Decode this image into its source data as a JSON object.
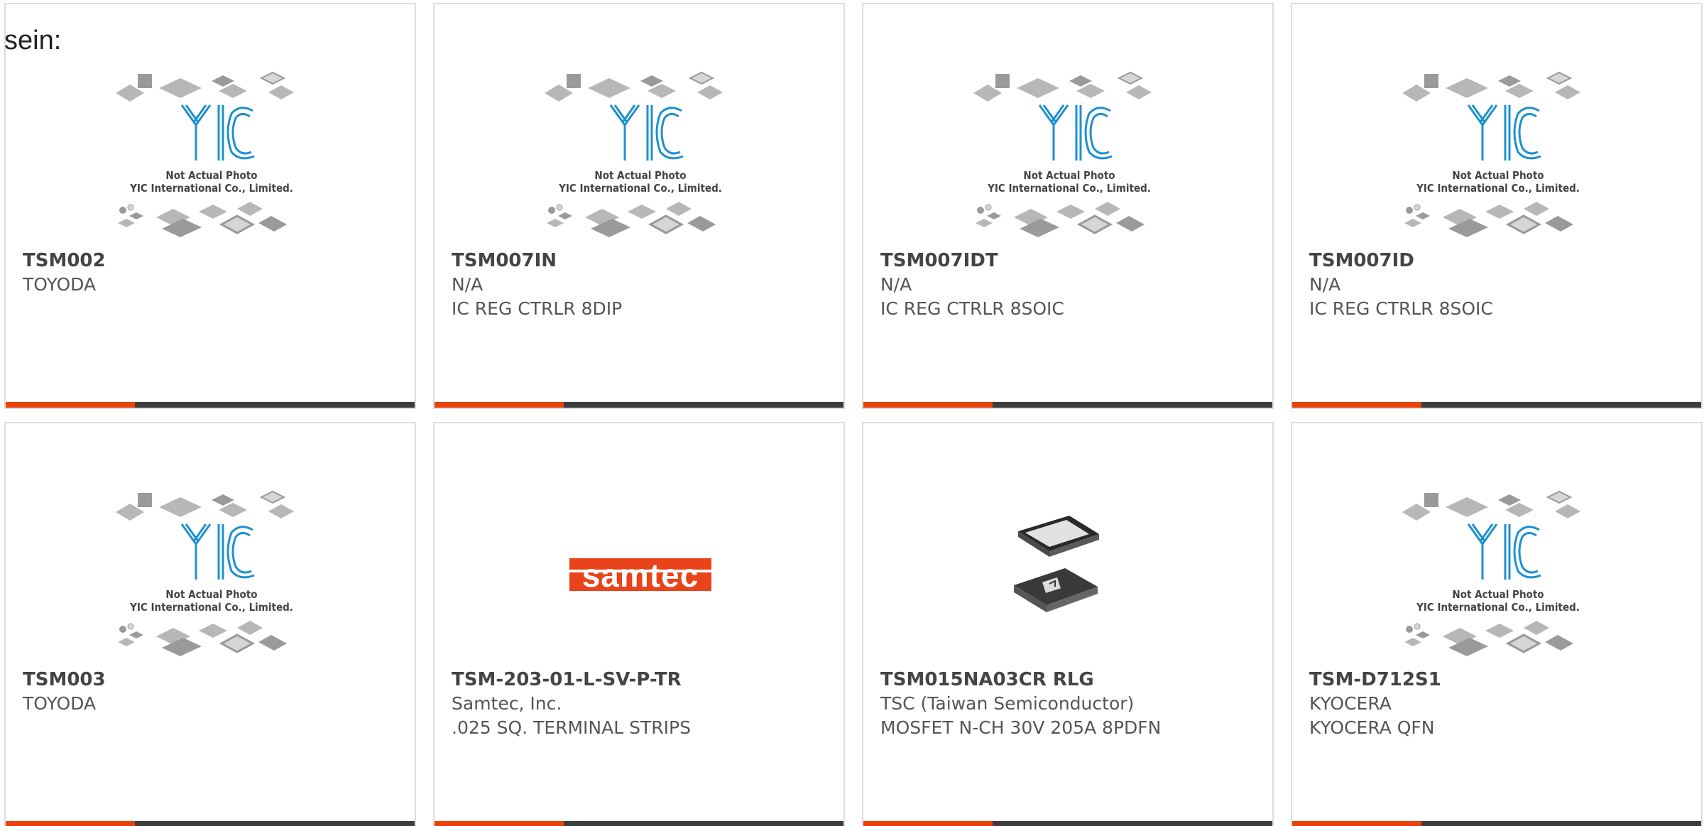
{
  "leading_text": "sein:",
  "placeholder": {
    "caption_line1": "Not Actual Photo",
    "caption_line2": "YIC International Co., Limited.",
    "logo_text": "YIC"
  },
  "colors": {
    "accent": "#e8430d",
    "bar": "#3d3d3d",
    "border": "#dddddd",
    "yic_blue": "#1e90d0",
    "samtec_orange": "#e8431a"
  },
  "cards": [
    {
      "part_number": "TSM002",
      "manufacturer": "TOYODA",
      "description": "",
      "image": "yic-placeholder"
    },
    {
      "part_number": "TSM007IN",
      "manufacturer": "N/A",
      "description": "IC REG CTRLR 8DIP",
      "image": "yic-placeholder"
    },
    {
      "part_number": "TSM007IDT",
      "manufacturer": "N/A",
      "description": "IC REG CTRLR 8SOIC",
      "image": "yic-placeholder"
    },
    {
      "part_number": "TSM007ID",
      "manufacturer": "N/A",
      "description": "IC REG CTRLR 8SOIC",
      "image": "yic-placeholder"
    },
    {
      "part_number": "TSM003",
      "manufacturer": "TOYODA",
      "description": "",
      "image": "yic-placeholder"
    },
    {
      "part_number": "TSM-203-01-L-SV-P-TR",
      "manufacturer": "Samtec, Inc.",
      "description": ".025 SQ. TERMINAL STRIPS",
      "image": "samtec-logo",
      "logo_text": "samtec"
    },
    {
      "part_number": "TSM015NA03CR RLG",
      "manufacturer": "TSC (Taiwan Semiconductor)",
      "description": "MOSFET N-CH 30V 205A 8PDFN",
      "image": "pdfn-chip-photo"
    },
    {
      "part_number": "TSM-D712S1",
      "manufacturer": "KYOCERA",
      "description": "KYOCERA QFN",
      "image": "yic-placeholder"
    }
  ]
}
